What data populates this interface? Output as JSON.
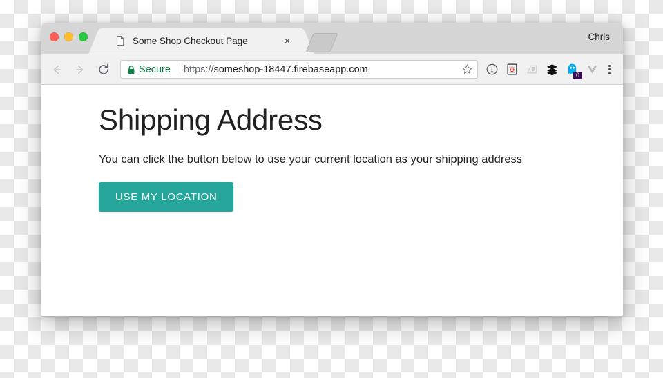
{
  "window": {
    "traffic_lights": [
      {
        "name": "close",
        "color": "#ff5f57"
      },
      {
        "name": "minimize",
        "color": "#febc2e"
      },
      {
        "name": "maximize",
        "color": "#28c840"
      }
    ],
    "profile_name": "Chris"
  },
  "tab": {
    "title": "Some Shop Checkout Page",
    "favicon": "page-icon",
    "close_label": "×",
    "new_tab_label": ""
  },
  "toolbar": {
    "back_icon": "arrow-left-icon",
    "forward_icon": "arrow-right-icon",
    "reload_icon": "reload-icon",
    "security_label": "Secure",
    "security_color": "#0b8043",
    "url_scheme": "https://",
    "url_host": "someshop-18447.firebaseapp.com",
    "bookmark_icon": "star-icon",
    "extensions": [
      {
        "name": "info-circle-icon",
        "badge": null
      },
      {
        "name": "blocked-page-icon",
        "badge": null
      },
      {
        "name": "reader-list-icon",
        "badge": null
      },
      {
        "name": "layers-icon",
        "badge": null
      },
      {
        "name": "ghostery-icon",
        "badge": "0"
      },
      {
        "name": "vue-devtools-icon",
        "badge": null
      }
    ],
    "menu_icon": "three-dots-menu-icon"
  },
  "page": {
    "heading": "Shipping Address",
    "paragraph": "You can click the button below to use your current location as your shipping address",
    "button_label": "USE MY LOCATION",
    "button_color": "#26a69a"
  }
}
